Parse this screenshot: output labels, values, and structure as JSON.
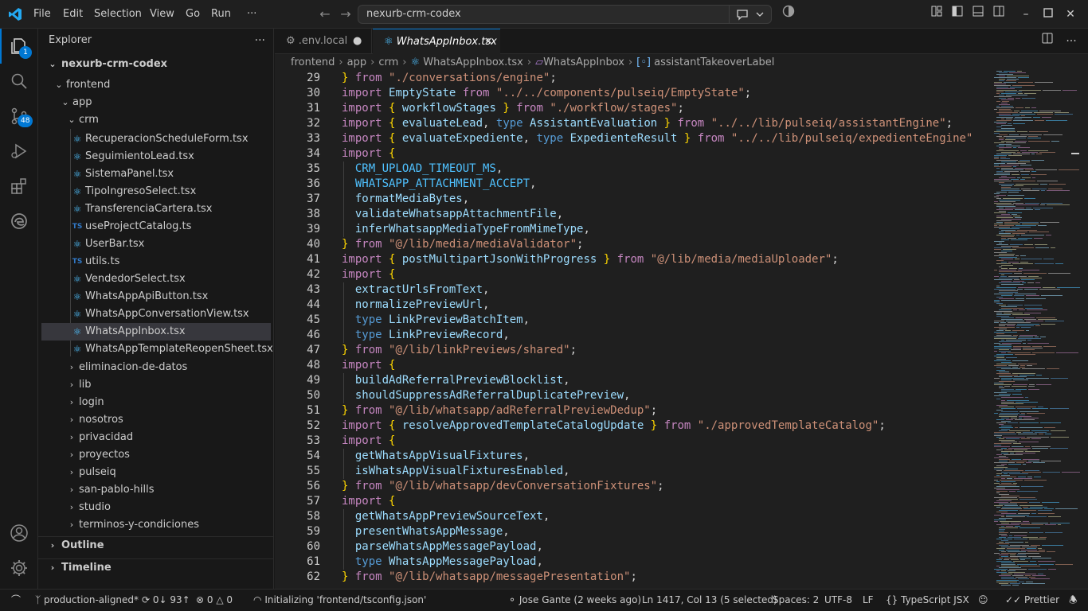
{
  "titlebar": {
    "menu": [
      "File",
      "Edit",
      "Selection",
      "View",
      "Go",
      "Run",
      "···"
    ],
    "search_text": "nexurb-crm-codex"
  },
  "activity": {
    "explorer_badge": "1",
    "source_control_badge": "48"
  },
  "sidebar": {
    "title": "Explorer",
    "root": "nexurb-crm-codex",
    "frontend": "frontend",
    "app": "app",
    "crm": "crm",
    "files": [
      {
        "name": "RecuperacionScheduleForm.tsx",
        "icon": "react"
      },
      {
        "name": "SeguimientoLead.tsx",
        "icon": "react"
      },
      {
        "name": "SistemaPanel.tsx",
        "icon": "react"
      },
      {
        "name": "TipoIngresoSelect.tsx",
        "icon": "react"
      },
      {
        "name": "TransferenciaCartera.tsx",
        "icon": "react"
      },
      {
        "name": "useProjectCatalog.ts",
        "icon": "ts"
      },
      {
        "name": "UserBar.tsx",
        "icon": "react"
      },
      {
        "name": "utils.ts",
        "icon": "ts"
      },
      {
        "name": "VendedorSelect.tsx",
        "icon": "react"
      },
      {
        "name": "WhatsAppApiButton.tsx",
        "icon": "react"
      },
      {
        "name": "WhatsAppConversationView.tsx",
        "icon": "react"
      },
      {
        "name": "WhatsAppInbox.tsx",
        "icon": "react",
        "selected": true
      },
      {
        "name": "WhatsAppTemplateReopenSheet.tsx",
        "icon": "react"
      }
    ],
    "folders": [
      "eliminacion-de-datos",
      "lib",
      "login",
      "nosotros",
      "privacidad",
      "proyectos",
      "pulseiq",
      "san-pablo-hills",
      "studio",
      "terminos-y-condiciones"
    ],
    "outline": "Outline",
    "timeline": "Timeline"
  },
  "tabs": [
    {
      "label": ".env.local",
      "state": "modified"
    },
    {
      "label": "WhatsAppInbox.tsx",
      "state": "active"
    }
  ],
  "breadcrumb": [
    "frontend",
    "app",
    "crm",
    "WhatsAppInbox.tsx",
    "WhatsAppInbox",
    "assistantTakeoverLabel"
  ],
  "code": [
    {
      "n": "29",
      "t": [
        [
          "br",
          "} "
        ],
        [
          "k",
          "from "
        ],
        [
          "s",
          "\"./conversations/engine\""
        ],
        [
          "p",
          ";"
        ]
      ]
    },
    {
      "n": "30",
      "t": [
        [
          "k",
          "import "
        ],
        [
          "v",
          "EmptyState "
        ],
        [
          "k",
          "from "
        ],
        [
          "s",
          "\"../../components/pulseiq/EmptyState\""
        ],
        [
          "p",
          ";"
        ]
      ]
    },
    {
      "n": "31",
      "t": [
        [
          "k",
          "import "
        ],
        [
          "br",
          "{ "
        ],
        [
          "v",
          "workflowStages "
        ],
        [
          "br",
          "} "
        ],
        [
          "k",
          "from "
        ],
        [
          "s",
          "\"./workflow/stages\""
        ],
        [
          "p",
          ";"
        ]
      ]
    },
    {
      "n": "32",
      "t": [
        [
          "k",
          "import "
        ],
        [
          "br",
          "{ "
        ],
        [
          "v",
          "evaluateLead"
        ],
        [
          "p",
          ", "
        ],
        [
          "kb",
          "type "
        ],
        [
          "v",
          "AssistantEvaluation "
        ],
        [
          "br",
          "} "
        ],
        [
          "k",
          "from "
        ],
        [
          "s",
          "\"../../lib/pulseiq/assistantEngine\""
        ],
        [
          "p",
          ";"
        ]
      ]
    },
    {
      "n": "33",
      "t": [
        [
          "k",
          "import "
        ],
        [
          "br",
          "{ "
        ],
        [
          "v",
          "evaluateExpediente"
        ],
        [
          "p",
          ", "
        ],
        [
          "kb",
          "type "
        ],
        [
          "v",
          "ExpedienteResult "
        ],
        [
          "br",
          "} "
        ],
        [
          "k",
          "from "
        ],
        [
          "s",
          "\"../../lib/pulseiq/expedienteEngine\""
        ]
      ]
    },
    {
      "n": "34",
      "t": [
        [
          "k",
          "import "
        ],
        [
          "br",
          "{"
        ]
      ]
    },
    {
      "n": "35",
      "t": [
        [
          "p",
          "  "
        ],
        [
          "c",
          "CRM_UPLOAD_TIMEOUT_MS"
        ],
        [
          "p",
          ","
        ]
      ]
    },
    {
      "n": "36",
      "t": [
        [
          "p",
          "  "
        ],
        [
          "c",
          "WHATSAPP_ATTACHMENT_ACCEPT"
        ],
        [
          "p",
          ","
        ]
      ]
    },
    {
      "n": "37",
      "t": [
        [
          "p",
          "  "
        ],
        [
          "v",
          "formatMediaBytes"
        ],
        [
          "p",
          ","
        ]
      ]
    },
    {
      "n": "38",
      "t": [
        [
          "p",
          "  "
        ],
        [
          "v",
          "validateWhatsappAttachmentFile"
        ],
        [
          "p",
          ","
        ]
      ]
    },
    {
      "n": "39",
      "t": [
        [
          "p",
          "  "
        ],
        [
          "v",
          "inferWhatsappMediaTypeFromMimeType"
        ],
        [
          "p",
          ","
        ]
      ]
    },
    {
      "n": "40",
      "t": [
        [
          "br",
          "} "
        ],
        [
          "k",
          "from "
        ],
        [
          "s",
          "\"@/lib/media/mediaValidator\""
        ],
        [
          "p",
          ";"
        ]
      ]
    },
    {
      "n": "41",
      "t": [
        [
          "k",
          "import "
        ],
        [
          "br",
          "{ "
        ],
        [
          "v",
          "postMultipartJsonWithProgress "
        ],
        [
          "br",
          "} "
        ],
        [
          "k",
          "from "
        ],
        [
          "s",
          "\"@/lib/media/mediaUploader\""
        ],
        [
          "p",
          ";"
        ]
      ]
    },
    {
      "n": "42",
      "t": [
        [
          "k",
          "import "
        ],
        [
          "br",
          "{"
        ]
      ]
    },
    {
      "n": "43",
      "t": [
        [
          "p",
          "  "
        ],
        [
          "v",
          "extractUrlsFromText"
        ],
        [
          "p",
          ","
        ]
      ]
    },
    {
      "n": "44",
      "t": [
        [
          "p",
          "  "
        ],
        [
          "v",
          "normalizePreviewUrl"
        ],
        [
          "p",
          ","
        ]
      ]
    },
    {
      "n": "45",
      "t": [
        [
          "p",
          "  "
        ],
        [
          "kb",
          "type "
        ],
        [
          "v",
          "LinkPreviewBatchItem"
        ],
        [
          "p",
          ","
        ]
      ]
    },
    {
      "n": "46",
      "t": [
        [
          "p",
          "  "
        ],
        [
          "kb",
          "type "
        ],
        [
          "v",
          "LinkPreviewRecord"
        ],
        [
          "p",
          ","
        ]
      ]
    },
    {
      "n": "47",
      "t": [
        [
          "br",
          "} "
        ],
        [
          "k",
          "from "
        ],
        [
          "s",
          "\"@/lib/linkPreviews/shared\""
        ],
        [
          "p",
          ";"
        ]
      ]
    },
    {
      "n": "48",
      "t": [
        [
          "k",
          "import "
        ],
        [
          "br",
          "{"
        ]
      ]
    },
    {
      "n": "49",
      "t": [
        [
          "p",
          "  "
        ],
        [
          "v",
          "buildAdReferralPreviewBlocklist"
        ],
        [
          "p",
          ","
        ]
      ]
    },
    {
      "n": "50",
      "t": [
        [
          "p",
          "  "
        ],
        [
          "v",
          "shouldSuppressAdReferralDuplicatePreview"
        ],
        [
          "p",
          ","
        ]
      ]
    },
    {
      "n": "51",
      "t": [
        [
          "br",
          "} "
        ],
        [
          "k",
          "from "
        ],
        [
          "s",
          "\"@/lib/whatsapp/adReferralPreviewDedup\""
        ],
        [
          "p",
          ";"
        ]
      ]
    },
    {
      "n": "52",
      "t": [
        [
          "k",
          "import "
        ],
        [
          "br",
          "{ "
        ],
        [
          "v",
          "resolveApprovedTemplateCatalogUpdate "
        ],
        [
          "br",
          "} "
        ],
        [
          "k",
          "from "
        ],
        [
          "s",
          "\"./approvedTemplateCatalog\""
        ],
        [
          "p",
          ";"
        ]
      ]
    },
    {
      "n": "53",
      "t": [
        [
          "k",
          "import "
        ],
        [
          "br",
          "{"
        ]
      ]
    },
    {
      "n": "54",
      "t": [
        [
          "p",
          "  "
        ],
        [
          "v",
          "getWhatsAppVisualFixtures"
        ],
        [
          "p",
          ","
        ]
      ]
    },
    {
      "n": "55",
      "t": [
        [
          "p",
          "  "
        ],
        [
          "v",
          "isWhatsAppVisualFixturesEnabled"
        ],
        [
          "p",
          ","
        ]
      ]
    },
    {
      "n": "56",
      "t": [
        [
          "br",
          "} "
        ],
        [
          "k",
          "from "
        ],
        [
          "s",
          "\"@/lib/whatsapp/devConversationFixtures\""
        ],
        [
          "p",
          ";"
        ]
      ]
    },
    {
      "n": "57",
      "t": [
        [
          "k",
          "import "
        ],
        [
          "br",
          "{"
        ]
      ]
    },
    {
      "n": "58",
      "t": [
        [
          "p",
          "  "
        ],
        [
          "v",
          "getWhatsAppPreviewSourceText"
        ],
        [
          "p",
          ","
        ]
      ]
    },
    {
      "n": "59",
      "t": [
        [
          "p",
          "  "
        ],
        [
          "v",
          "presentWhatsAppMessage"
        ],
        [
          "p",
          ","
        ]
      ]
    },
    {
      "n": "60",
      "t": [
        [
          "p",
          "  "
        ],
        [
          "v",
          "parseWhatsAppMessagePayload"
        ],
        [
          "p",
          ","
        ]
      ]
    },
    {
      "n": "61",
      "t": [
        [
          "p",
          "  "
        ],
        [
          "kb",
          "type "
        ],
        [
          "v",
          "WhatsAppMessagePayload"
        ],
        [
          "p",
          ","
        ]
      ]
    },
    {
      "n": "62",
      "t": [
        [
          "br",
          "} "
        ],
        [
          "k",
          "from "
        ],
        [
          "s",
          "\"@/lib/whatsapp/messagePresentation\""
        ],
        [
          "p",
          ";"
        ]
      ]
    }
  ],
  "statusbar": {
    "branch": "production-aligned*",
    "sync": "0↓ 93↑",
    "errors": "0",
    "warnings": "0",
    "task": "Initializing 'frontend/tsconfig.json'",
    "blame": "Jose Gante (2 weeks ago)",
    "position": "Ln 1417, Col 13 (5 selected)",
    "spaces": "Spaces: 2",
    "encoding": "UTF-8",
    "eol": "LF",
    "language": "TypeScript JSX",
    "prettier": "Prettier"
  },
  "colors": {
    "accent": "#0078d4",
    "keyword": "#c586c0",
    "string": "#ce9178",
    "variable": "#9cdcfe",
    "constant": "#4fc1ff",
    "bracket": "#ffd700"
  }
}
